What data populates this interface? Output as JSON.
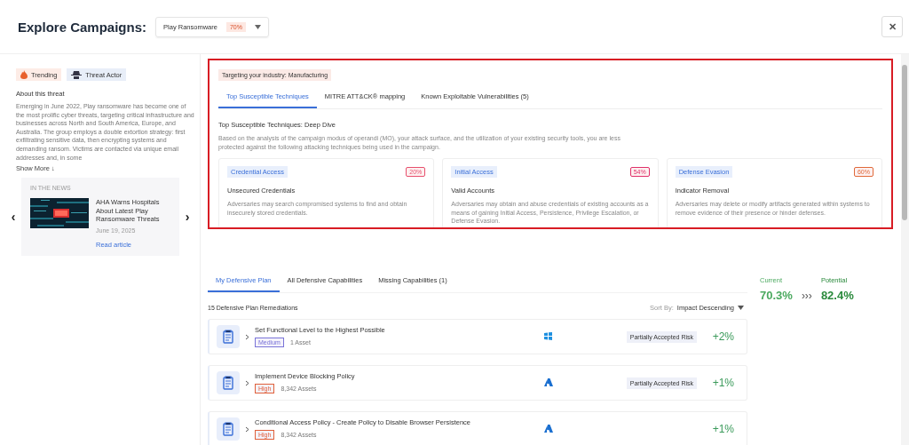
{
  "header": {
    "title": "Explore Campaigns:",
    "campaign_select": {
      "value": "Play Ransomware",
      "badge": "70%"
    },
    "close": "✕"
  },
  "sidebar": {
    "tags": [
      {
        "kind": "trending",
        "label": "Trending"
      },
      {
        "kind": "actor",
        "label": "Threat Actor"
      }
    ],
    "about_title": "About this threat",
    "about_text": "Emerging in June 2022, Play ransomware has become one of the most prolific cyber threats, targeting critical infrastructure and businesses across North and South America, Europe, and Australia. The group employs a double extortion strategy: first exfiltrating sensitive data, then encrypting systems and demanding ransom. Victims are contacted via unique email addresses and, in some",
    "show_more": "Show More ↓",
    "news": {
      "heading": "IN THE NEWS",
      "title": "AHA Warns Hospitals About Latest Play Ransomware Threats",
      "date": "June 19, 2025",
      "link": "Read article",
      "prev": "‹",
      "next": "›"
    }
  },
  "industry_badge": "Targeting your industry: Manufacturing",
  "technique_tabs": [
    {
      "label": "Top Susceptible Techniques",
      "selected": true
    },
    {
      "label": "MITRE ATT&CK® mapping",
      "selected": false
    },
    {
      "label": "Known Exploitable Vulnerabilities (5)",
      "selected": false
    }
  ],
  "deep_dive": {
    "title": "Top Susceptible Techniques: Deep Dive",
    "description": "Based on the analysis of the campaign modus of operandi (MO), your attack surface, and the utilization of your existing security tools, you are less protected against the following attacking techniques being used in the campaign."
  },
  "techniques": [
    {
      "tactic": "Credential Access",
      "percent": "20%",
      "color": "#e8506e",
      "name": "Unsecured Credentials",
      "description": "Adversaries may search compromised systems to find and obtain insecurely stored credentials."
    },
    {
      "tactic": "Initial Access",
      "percent": "54%",
      "color": "#e0306a",
      "name": "Valid Accounts",
      "description": "Adversaries may obtain and abuse credentials of existing accounts as a means of gaining Initial Access, Persistence, Privilege Escalation, or Defense Evasion."
    },
    {
      "tactic": "Defense Evasion",
      "percent": "60%",
      "color": "#e06a3a",
      "name": "Indicator Removal",
      "description": "Adversaries may delete or modify artifacts generated within systems to remove evidence of their presence or hinder defenses."
    }
  ],
  "plan_tabs": [
    {
      "label": "My Defensive Plan",
      "selected": true
    },
    {
      "label": "All Defensive Capabilities",
      "selected": false
    },
    {
      "label": "Missing Capabilities (1)",
      "selected": false
    }
  ],
  "remediation_count": "15 Defensive Plan Remediations",
  "sort": {
    "label": "Sort By:",
    "value": "Impact Descending"
  },
  "remediations": [
    {
      "title": "Set Functional Level to the Highest Possible",
      "severity": "Medium",
      "color": "#7a74d8",
      "assets": "1 Asset",
      "kind": "windows",
      "risk": "Partially Accepted Risk",
      "impact": "+2%"
    },
    {
      "title": "Implement Device Blocking Policy",
      "severity": "High",
      "color": "#e0603a",
      "assets": "8,342 Assets",
      "kind": "azure",
      "risk": "Partially Accepted Risk",
      "impact": "+1%"
    },
    {
      "title": "Conditional Access Policy - Create Policy to Disable Browser Persistence",
      "severity": "High",
      "color": "#e0603a",
      "assets": "8,342 Assets",
      "kind": "azure",
      "impact": "+1%"
    }
  ],
  "score": {
    "current_label": "Current",
    "current": "70.3%",
    "arrow": "›››",
    "potential_label": "Potential",
    "potential": "82.4%"
  }
}
